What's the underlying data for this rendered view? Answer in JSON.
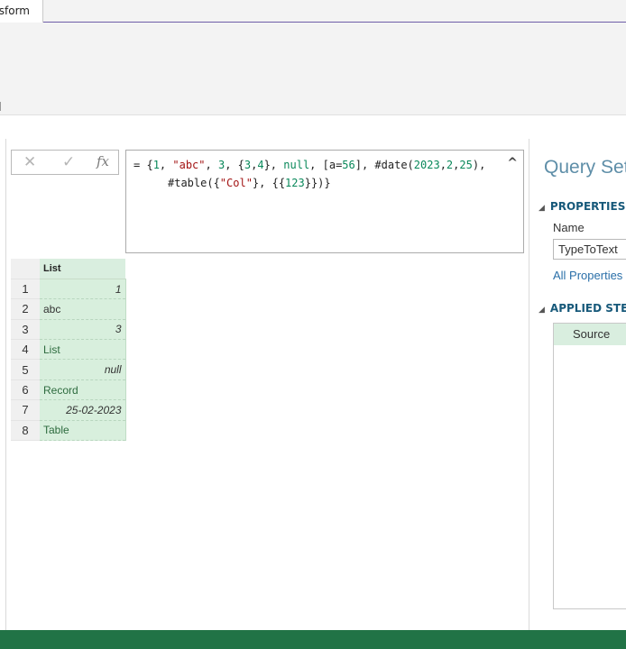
{
  "ribbon": {
    "active_tab": "nsform"
  },
  "formula_bar": {
    "cancel_icon": "close-icon",
    "commit_icon": "check-icon",
    "fx_label": "fx",
    "line1_parts": [
      "= {",
      "1",
      ", ",
      "\"abc\"",
      ", ",
      "3",
      ", {",
      "3",
      ",",
      "4",
      "}, ",
      "null",
      ", [a=",
      "56",
      "], #date(",
      "2023",
      ",",
      "2",
      ",",
      "25",
      "),"
    ],
    "line2_parts": [
      "#table({",
      "\"Col\"",
      "}, {{",
      "123",
      "}})}"
    ],
    "collapse_icon": "chevron-up-icon"
  },
  "grid": {
    "column_header": "List",
    "rows": [
      {
        "index": "1",
        "value": "1"
      },
      {
        "index": "2",
        "value": "abc"
      },
      {
        "index": "3",
        "value": "3"
      },
      {
        "index": "4",
        "value": "List"
      },
      {
        "index": "5",
        "value": "null"
      },
      {
        "index": "6",
        "value": "Record"
      },
      {
        "index": "7",
        "value": "25-02-2023"
      },
      {
        "index": "8",
        "value": "Table"
      }
    ]
  },
  "query_settings": {
    "title": "Query Set",
    "properties_header": "PROPERTIES",
    "name_label": "Name",
    "name_value": "TypeToText",
    "all_properties_link": "All Properties",
    "applied_steps_header": "APPLIED STE",
    "steps": [
      "Source"
    ]
  },
  "colors": {
    "status_bar": "#217346",
    "grid_cell": "#d8efdd",
    "accent_link": "#2a6fa8"
  }
}
